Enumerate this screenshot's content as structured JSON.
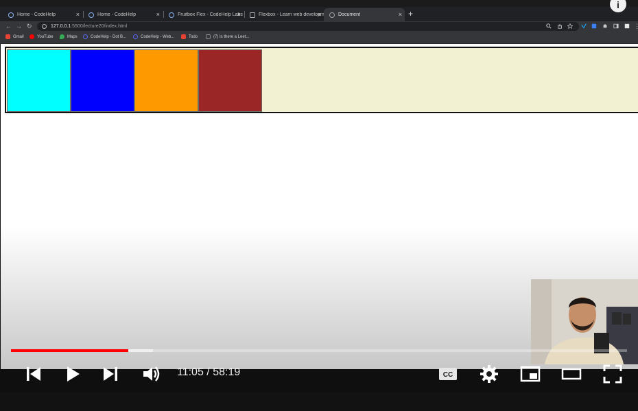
{
  "browser": {
    "tabs": [
      {
        "title": "Home - CodeHelp",
        "active": false
      },
      {
        "title": "Home - CodeHelp",
        "active": false
      },
      {
        "title": "Fruitbox Flex - CodeHelp Labs",
        "active": false
      },
      {
        "title": "Flexbox - Learn web developm",
        "active": false
      },
      {
        "title": "Document",
        "active": true
      }
    ],
    "new_tab_label": "+",
    "close_label": "×",
    "url": {
      "host": "127.0.0.1",
      "path": ":5500/lecture20/index.html"
    },
    "bookmarks": [
      {
        "label": "Gmail",
        "color": "#ea4335"
      },
      {
        "label": "YouTube",
        "color": "#ff0000"
      },
      {
        "label": "Maps",
        "color": "#34a853"
      },
      {
        "label": "CodeHelp - Dot B...",
        "color": "#5865f2"
      },
      {
        "label": "CodeHelp - Web...",
        "color": "#5865f2"
      },
      {
        "label": "Todo",
        "color": "#e44332"
      },
      {
        "label": "(7) Is there a Leet...",
        "color": "#f89f1b"
      }
    ]
  },
  "page": {
    "background": "#f2f2d2",
    "boxes": [
      {
        "color": "#00ffff"
      },
      {
        "color": "#0000ff"
      },
      {
        "color": "#ff9900"
      },
      {
        "color": "#9b2626"
      }
    ]
  },
  "player": {
    "current_time": "11:05",
    "duration": "58:19",
    "time_display": "11:05 / 58:19",
    "played_fraction": 0.19,
    "buffered_fraction": 0.23,
    "info_label": "i",
    "cc_label": "CC"
  }
}
